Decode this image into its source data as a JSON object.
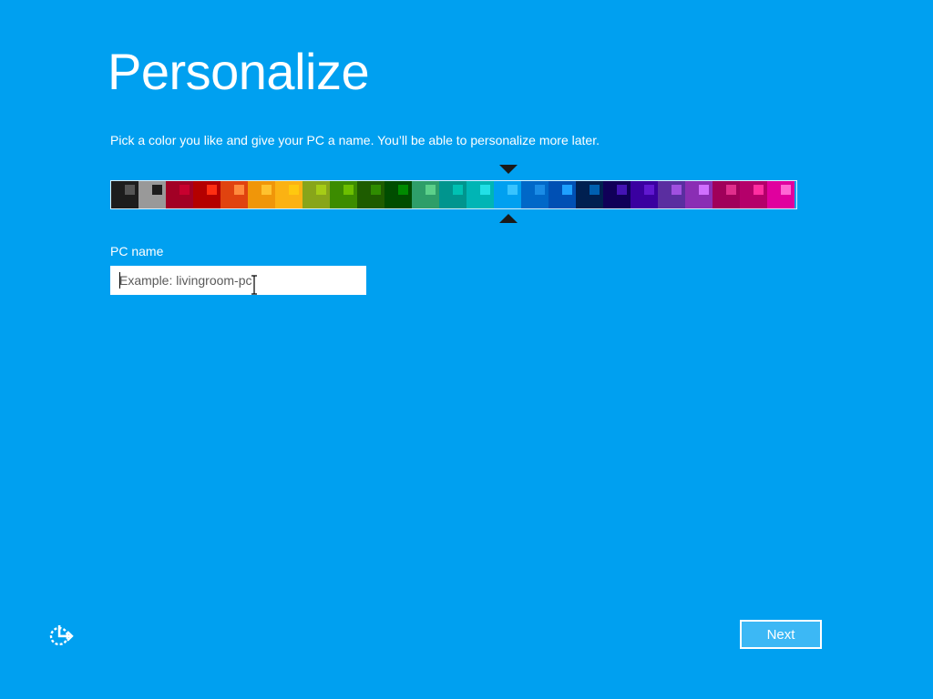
{
  "page": {
    "title": "Personalize",
    "subtitle": "Pick a color you like and give your PC a name. You’ll be able to personalize more later."
  },
  "palette": {
    "selected_index": 14,
    "swatches": [
      {
        "bg": "#1d1d1d",
        "chip": "#555555"
      },
      {
        "bg": "#999999",
        "chip": "#1d1d1d"
      },
      {
        "bg": "#a20025",
        "chip": "#c8002f"
      },
      {
        "bg": "#b40000",
        "chip": "#ff2e12"
      },
      {
        "bg": "#e0430f",
        "chip": "#ff8a3c"
      },
      {
        "bg": "#f09609",
        "chip": "#ffc22e"
      },
      {
        "bg": "#fbb213",
        "chip": "#ffc80f"
      },
      {
        "bg": "#88a51a",
        "chip": "#a6cc16"
      },
      {
        "bg": "#3c8c00",
        "chip": "#6cbf00"
      },
      {
        "bg": "#1e5c00",
        "chip": "#2f8c00"
      },
      {
        "bg": "#004d00",
        "chip": "#008a00"
      },
      {
        "bg": "#2e9e69",
        "chip": "#5cd08a"
      },
      {
        "bg": "#00958e",
        "chip": "#00c1b3"
      },
      {
        "bg": "#00b5b5",
        "chip": "#22e0e6"
      },
      {
        "bg": "#00a0f0",
        "chip": "#38c4ff"
      },
      {
        "bg": "#0068c8",
        "chip": "#1a8ce6"
      },
      {
        "bg": "#0050b4",
        "chip": "#1ea0ff"
      },
      {
        "bg": "#002050",
        "chip": "#0060b0"
      },
      {
        "bg": "#100058",
        "chip": "#4414b4"
      },
      {
        "bg": "#3a00a0",
        "chip": "#6018d0"
      },
      {
        "bg": "#5a2ea0",
        "chip": "#a050e0"
      },
      {
        "bg": "#8a2eb4",
        "chip": "#d070ff"
      },
      {
        "bg": "#a0005a",
        "chip": "#e02e8c"
      },
      {
        "bg": "#b4006a",
        "chip": "#ff2ea0"
      },
      {
        "bg": "#e0009e",
        "chip": "#ff66d4"
      }
    ]
  },
  "pc_name": {
    "label": "PC name",
    "placeholder": "Example: livingroom-pc",
    "value": ""
  },
  "footer": {
    "accessibility_icon": "ease-of-access-icon",
    "next_label": "Next"
  },
  "colors": {
    "background": "#00a0f0",
    "button_fill": "#3cb8f5",
    "marker": "#1a1a1a"
  }
}
